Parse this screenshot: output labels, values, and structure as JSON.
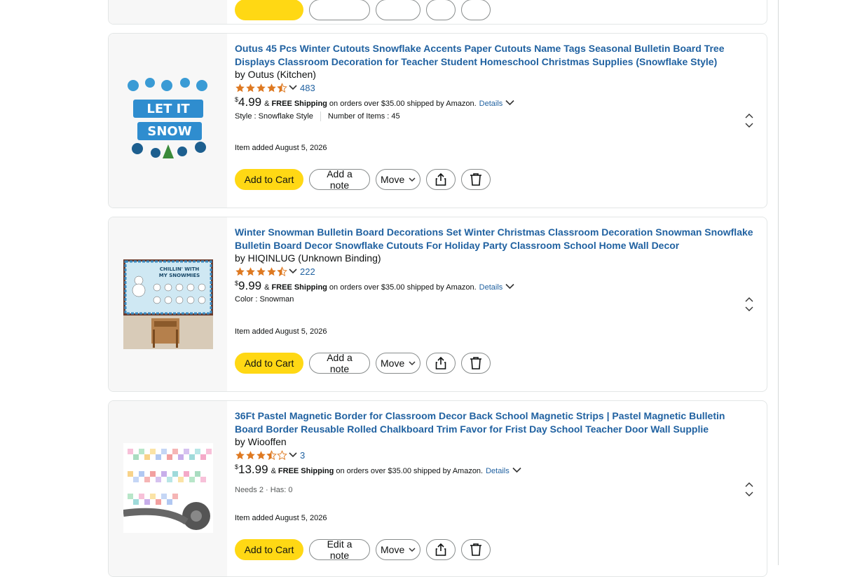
{
  "colors": {
    "link": "#2162a1",
    "add_btn": "#ffd814",
    "star": "#de7921"
  },
  "items": [
    {
      "title": "Outus 45 Pcs Winter Cutouts Snowflake Accents Paper Cutouts Name Tags Seasonal Bulletin Board Tree Displays Classroom Decoration for Teacher Student Homeschool Christmas Supplies (Snowflake Style)",
      "byline": "by Outus (Kitchen)",
      "rating": 4.5,
      "review_count": "483",
      "price_symbol": "$",
      "price": "4.99",
      "shipping_pre": "&",
      "shipping_free": "FREE Shipping",
      "shipping_post": "on orders over $35.00 shipped by Amazon.",
      "details_label": "Details",
      "attr1": "Style : Snowflake Style",
      "attr2": "Number of Items : 45",
      "added": "Item added August 5, 2026",
      "add_label": "Add to Cart",
      "note_label": "Add a note",
      "move_label": "Move"
    },
    {
      "title": "Winter Snowman Bulletin Board Decorations Set Winter Christmas Classroom Decoration Snowman Snowflake Bulletin Board Decor Snowflake Cutouts For Holiday Party Classroom School Home Wall Decor",
      "byline": "by HIQINLUG (Unknown Binding)",
      "rating": 4.5,
      "review_count": "222",
      "price_symbol": "$",
      "price": "9.99",
      "shipping_pre": "&",
      "shipping_free": "FREE Shipping",
      "shipping_post": "on orders over $35.00 shipped by Amazon.",
      "details_label": "Details",
      "attr1": "Color : Snowman",
      "added": "Item added August 5, 2026",
      "add_label": "Add to Cart",
      "note_label": "Add a note",
      "move_label": "Move"
    },
    {
      "title": "36Ft Pastel Magnetic Border for Classroom Decor Back School Magnetic Strips | Pastel Magnetic Bulletin Board Border Reusable Rolled Chalkboard Trim Favor for Frist Day School Teacher Door Wall Supplie",
      "byline": "by Wiooffen",
      "rating": 3.5,
      "review_count": "3",
      "price_symbol": "$",
      "price": "13.99",
      "shipping_pre": "&",
      "shipping_free": "FREE Shipping",
      "shipping_post": "on orders over $35.00 shipped by Amazon.",
      "details_label": "Details",
      "needs": "Needs 2 · Has: 0",
      "added": "Item added August 5, 2026",
      "add_label": "Add to Cart",
      "note_label": "Edit a note",
      "move_label": "Move"
    }
  ]
}
